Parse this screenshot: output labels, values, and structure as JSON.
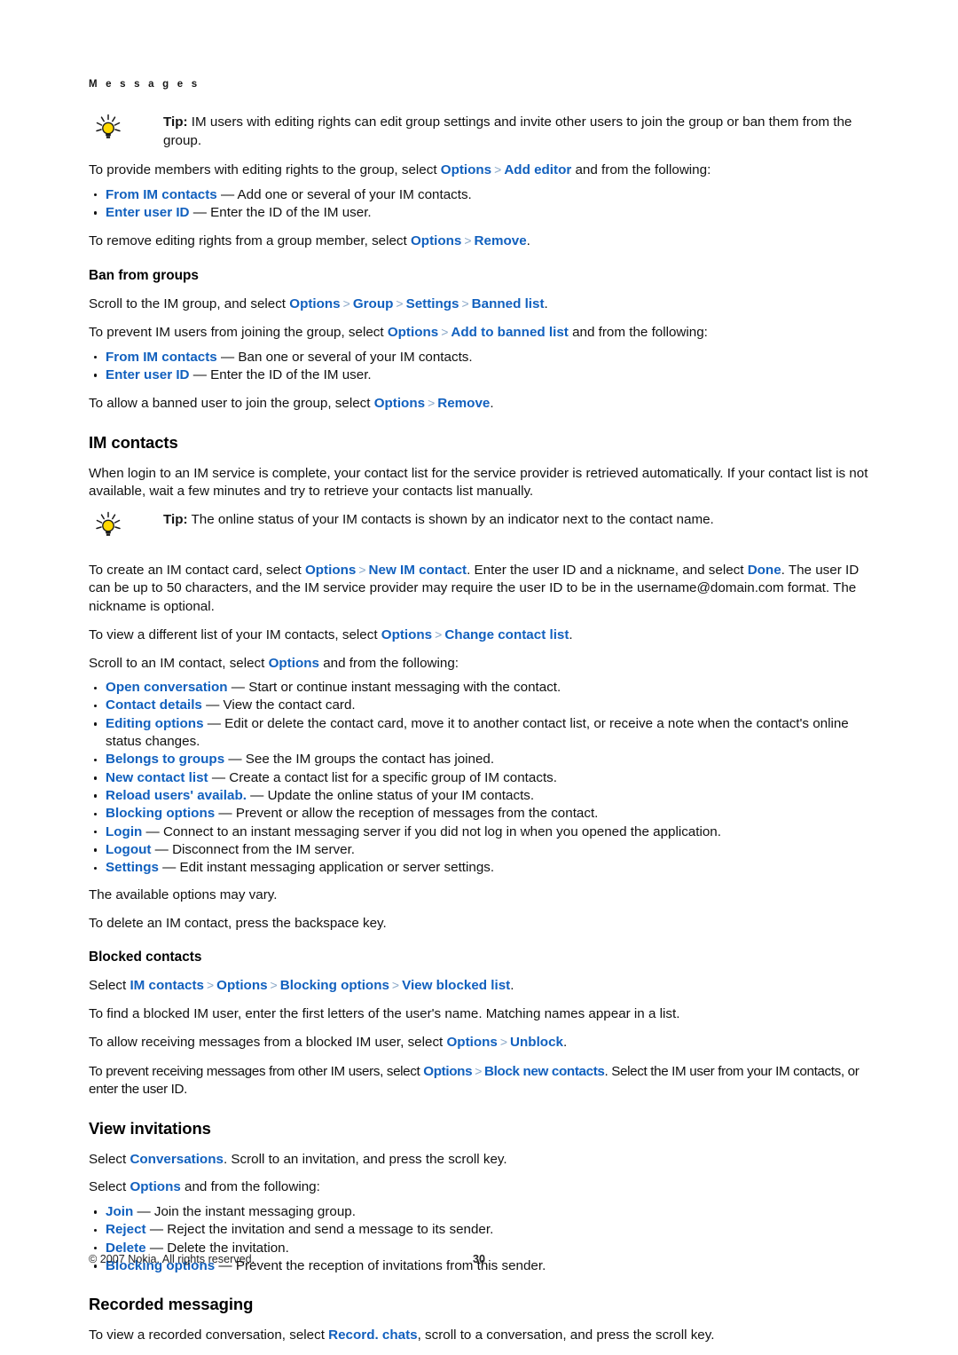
{
  "document": {
    "running_head": "M e s s a g e s",
    "page_number": "30",
    "copyright": "© 2007 Nokia. All rights reserved."
  },
  "icons": {
    "tip": "lightbulb-tip-icon"
  },
  "separator": ">",
  "colors": {
    "link": "#1160BE",
    "separator": "#8AA8C8",
    "text": "#111111",
    "bulb_fill": "#FFD900"
  },
  "sections": {
    "ban_from_groups": {
      "tip1": {
        "label": "Tip:",
        "text": " IM users with editing rights can edit group settings and invite other users to join the group or ban them from the group."
      },
      "provide_lead_1": "To provide members with editing rights to the group, select ",
      "provide_opt": "Options",
      "provide_add_editor": "Add editor",
      "provide_lead_2": " and from the following:",
      "bullets_editor": [
        {
          "term": "From IM contacts",
          "desc": " — Add one or several of your IM contacts."
        },
        {
          "term": "Enter user ID",
          "desc": " — Enter the ID of the IM user."
        }
      ],
      "remove_lead": "To remove editing rights from a group member, select ",
      "remove_opt": "Options",
      "remove_item": "Remove",
      "remove_tail": ".",
      "heading": "Ban from groups",
      "scroll_lead": "Scroll to the IM group, and select ",
      "scroll_opt": "Options",
      "scroll_group": "Group",
      "scroll_settings": "Settings",
      "scroll_banned": "Banned list",
      "scroll_tail": ".",
      "prevent_lead_1": "To prevent IM users from joining the group, select ",
      "prevent_opt": "Options",
      "prevent_add": "Add to banned list",
      "prevent_lead_2": " and from the following:",
      "bullets_ban": [
        {
          "term": "From IM contacts",
          "desc": " — Ban one or several of your IM contacts."
        },
        {
          "term": "Enter user ID",
          "desc": " — Enter the ID of the IM user."
        }
      ],
      "allow_lead": "To allow a banned user to join the group, select ",
      "allow_opt": "Options",
      "allow_item": "Remove",
      "allow_tail": "."
    },
    "im_contacts": {
      "heading": "IM contacts",
      "intro": "When login to an IM service is complete, your contact list for the service provider is retrieved automatically. If your contact list is not available, wait a few minutes and try to retrieve your contacts list manually.",
      "tip2": {
        "label": "Tip:",
        "text": " The online status of your IM contacts is shown by an indicator next to the contact name."
      },
      "create_lead_1": "To create an IM contact card, select ",
      "create_opt": "Options",
      "create_new": "New IM contact",
      "create_lead_2": ". Enter the user ID and a nickname, and select ",
      "create_done": "Done",
      "create_lead_3": ". The user ID can be up to 50 characters, and the IM service provider may require the user ID to be in the username@domain.com format. The nickname is optional.",
      "view_lead": "To view a different list of your IM contacts, select ",
      "view_opt": "Options",
      "view_change": "Change contact list",
      "view_tail": ".",
      "scroll_lead": "Scroll to an IM contact, select ",
      "scroll_opt": "Options",
      "scroll_tail": " and from the following:",
      "bullets": [
        {
          "term": "Open conversation",
          "desc": " — Start or continue instant messaging with the contact."
        },
        {
          "term": "Contact details",
          "desc": " — View the contact card."
        },
        {
          "term": "Editing options",
          "desc": " — Edit or delete the contact card, move it to another contact list, or receive a note when the contact's online status changes."
        },
        {
          "term": "Belongs to groups",
          "desc": " — See the IM groups the contact has joined."
        },
        {
          "term": "New contact list",
          "desc": " — Create a contact list for a specific group of IM contacts."
        },
        {
          "term": "Reload users' availab.",
          "desc": " — Update the online status of your IM contacts."
        },
        {
          "term": "Blocking options",
          "desc": " — Prevent or allow the reception of messages from the contact."
        },
        {
          "term": "Login",
          "desc": " — Connect to an instant messaging server if you did not log in when you opened the application."
        },
        {
          "term": "Logout",
          "desc": " — Disconnect from the IM server."
        },
        {
          "term": "Settings",
          "desc": " — Edit instant messaging application or server settings."
        }
      ],
      "may_vary": "The available options may vary.",
      "delete_contact": "To delete an IM contact, press the backspace key."
    },
    "blocked_contacts": {
      "heading": "Blocked contacts",
      "select_lead": "Select ",
      "select_im": "IM contacts",
      "select_opt": "Options",
      "select_blocking": "Blocking options",
      "select_view": "View blocked list",
      "select_tail": ".",
      "find": "To find a blocked IM user, enter the first letters of the user's name. Matching names appear in a list.",
      "allow_lead": "To allow receiving messages from a blocked IM user, select ",
      "allow_opt": "Options",
      "allow_unblock": "Unblock",
      "allow_tail": ".",
      "prevent_lead": "To prevent receiving messages from other IM users, select ",
      "prevent_opt": "Options",
      "prevent_block": "Block new contacts",
      "prevent_tail": ". Select the IM user from your IM contacts, or enter the user ID."
    },
    "view_invitations": {
      "heading": "View invitations",
      "select_lead": "Select ",
      "select_conv": "Conversations",
      "select_tail": ". Scroll to an invitation, and press the scroll key.",
      "options_lead": "Select ",
      "options_opt": "Options",
      "options_tail": " and from the following:",
      "bullets": [
        {
          "term": "Join",
          "desc": " — Join the instant messaging group."
        },
        {
          "term": "Reject",
          "desc": " — Reject the invitation and send a message to its sender."
        },
        {
          "term": "Delete",
          "desc": " — Delete the invitation."
        },
        {
          "term": "Blocking options",
          "desc": " — Prevent the reception of invitations from this sender."
        }
      ]
    },
    "recorded_messaging": {
      "heading": "Recorded messaging",
      "lead": "To view a recorded conversation, select ",
      "record_chats": "Record. chats",
      "tail": ", scroll to a conversation, and press the scroll key."
    }
  }
}
